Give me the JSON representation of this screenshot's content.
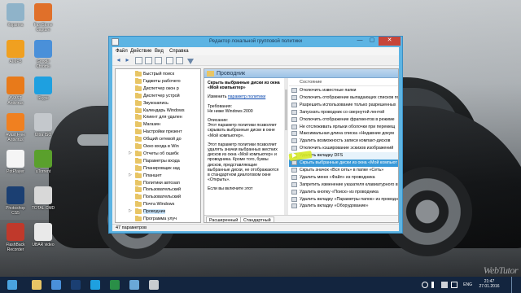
{
  "desktop": {
    "icons": [
      {
        "label": "Корзина",
        "color": "#8fb3c9"
      },
      {
        "label": "FastStone Capture",
        "color": "#e0702a"
      },
      {
        "label": "AIMP3",
        "color": "#f0a020"
      },
      {
        "label": "Google Chrome",
        "color": "#4a90d9"
      },
      {
        "label": "AVAST Antivirus",
        "color": "#e87a1a"
      },
      {
        "label": "Skype",
        "color": "#1ea0e0"
      },
      {
        "label": "Avast Free Antivirus",
        "color": "#f08020"
      },
      {
        "label": "Ultra ISO",
        "color": "#c4c8cc"
      },
      {
        "label": "PotPlayer",
        "color": "#f5f5f5"
      },
      {
        "label": "uTorrent",
        "color": "#5aa02c"
      },
      {
        "label": "Photoshop CS5",
        "color": "#1b3f72"
      },
      {
        "label": "TOTAL CMD",
        "color": "#d8d8d8"
      },
      {
        "label": "FlashBack Recorder",
        "color": "#c0392b"
      },
      {
        "label": "UBAR video",
        "color": "#e9e9e9"
      }
    ]
  },
  "window": {
    "title": "Редактор локальной групповой политики",
    "controls": {
      "minimize": "—",
      "maximize": "▢",
      "close": "✕"
    },
    "menu": [
      "Файл",
      "Действие",
      "Вид",
      "Справка"
    ],
    "tree": [
      {
        "label": "Быстрый поиск",
        "exp": ""
      },
      {
        "label": "Гаджеты рабочего",
        "exp": ""
      },
      {
        "label": "Диспетчер окон р",
        "exp": ""
      },
      {
        "label": "Диспетчер устрой",
        "exp": ""
      },
      {
        "label": "Звукозапись",
        "exp": ""
      },
      {
        "label": "Календарь Windows",
        "exp": ""
      },
      {
        "label": "Клиент для удален",
        "exp": ""
      },
      {
        "label": "Магазин",
        "exp": ""
      },
      {
        "label": "Настройки презент",
        "exp": ""
      },
      {
        "label": "Общий сетевой до",
        "exp": ""
      },
      {
        "label": "Окно входа в Win",
        "exp": ""
      },
      {
        "label": "Отчеты об ошибк",
        "exp": "▷"
      },
      {
        "label": "Параметры входа",
        "exp": ""
      },
      {
        "label": "Планировщик зад",
        "exp": ""
      },
      {
        "label": "Планшет",
        "exp": "▷"
      },
      {
        "label": "Политики автозап",
        "exp": ""
      },
      {
        "label": "Пользовательский",
        "exp": ""
      },
      {
        "label": "Пользовательский",
        "exp": ""
      },
      {
        "label": "Почта Windows",
        "exp": ""
      },
      {
        "label": "Проводник",
        "exp": "▷"
      },
      {
        "label": "Программа улуч",
        "exp": ""
      }
    ],
    "right_header": "Проводник",
    "description": {
      "title": "Скрыть выбранные диски из окна «Мой компьютер»",
      "change_prefix": "Изменить",
      "change_link": "параметр политики",
      "requirements_label": "Требования:",
      "requirements_value": "Не ниже Windows 2000",
      "description_label": "Описание:",
      "description_text": "Этот параметр политики позволяет скрывать выбранные диски в окне «Мой компьютер».",
      "body_text": "Этот параметр политики позволяет удалять значки выбранных жестких дисков из окна «Мой компьютер» и проводника. Кроме того, буквы дисков, представляющие выбранные диски, не отображаются в стандартном диалоговом окне «Открыть».",
      "tail_text": "Если вы включите этот"
    },
    "list_header": "Состояние",
    "list_items": [
      "Отключить известные папки",
      "Отключить отображение выпадающих списков поиска",
      "Разрешить использование только разрешенных",
      "Запускать проводник со свернутой лентой",
      "Отключить отображение фрагментов в режиме",
      "Не отслеживать ярлыки оболочки при перемещ",
      "Максимальная длина списка «Недавние докум",
      "Удалить возможность записи компакт-дисков",
      "Отключить кэширование эскизов изображений",
      "Удалить вкладку DFS",
      "Скрыть выбранные диски из окна «Мой компьют",
      "Скрыть значок «Вся сеть» в папке «Сеть»",
      "Удалить меню «Файл» из проводника",
      "Запретить изменение указателя клавиатурного вво",
      "Удалить кнопку «Поиск» из проводника",
      "Удалить вкладку «Параметры папок» из проводн",
      "Удалить вкладку «Оборудование»"
    ],
    "selected_index": 10,
    "tabs": [
      "Расширенный",
      "Стандартный"
    ],
    "status": "47 параметров"
  },
  "taskbar": {
    "apps": [
      {
        "name": "start",
        "color": "#4aa3df"
      },
      {
        "name": "explorer",
        "color": "#e8c565"
      },
      {
        "name": "chrome",
        "color": "#4a90d9"
      },
      {
        "name": "photoshop",
        "color": "#1b3f72"
      },
      {
        "name": "skype",
        "color": "#1ea0e0"
      },
      {
        "name": "excel",
        "color": "#2a8f47"
      },
      {
        "name": "app",
        "color": "#6aa8d8"
      },
      {
        "name": "gpedit",
        "color": "#c8ccd0"
      }
    ],
    "language": "ENG",
    "time": "21:47",
    "date": "27.01.2016"
  },
  "watermark": "WebTutor"
}
